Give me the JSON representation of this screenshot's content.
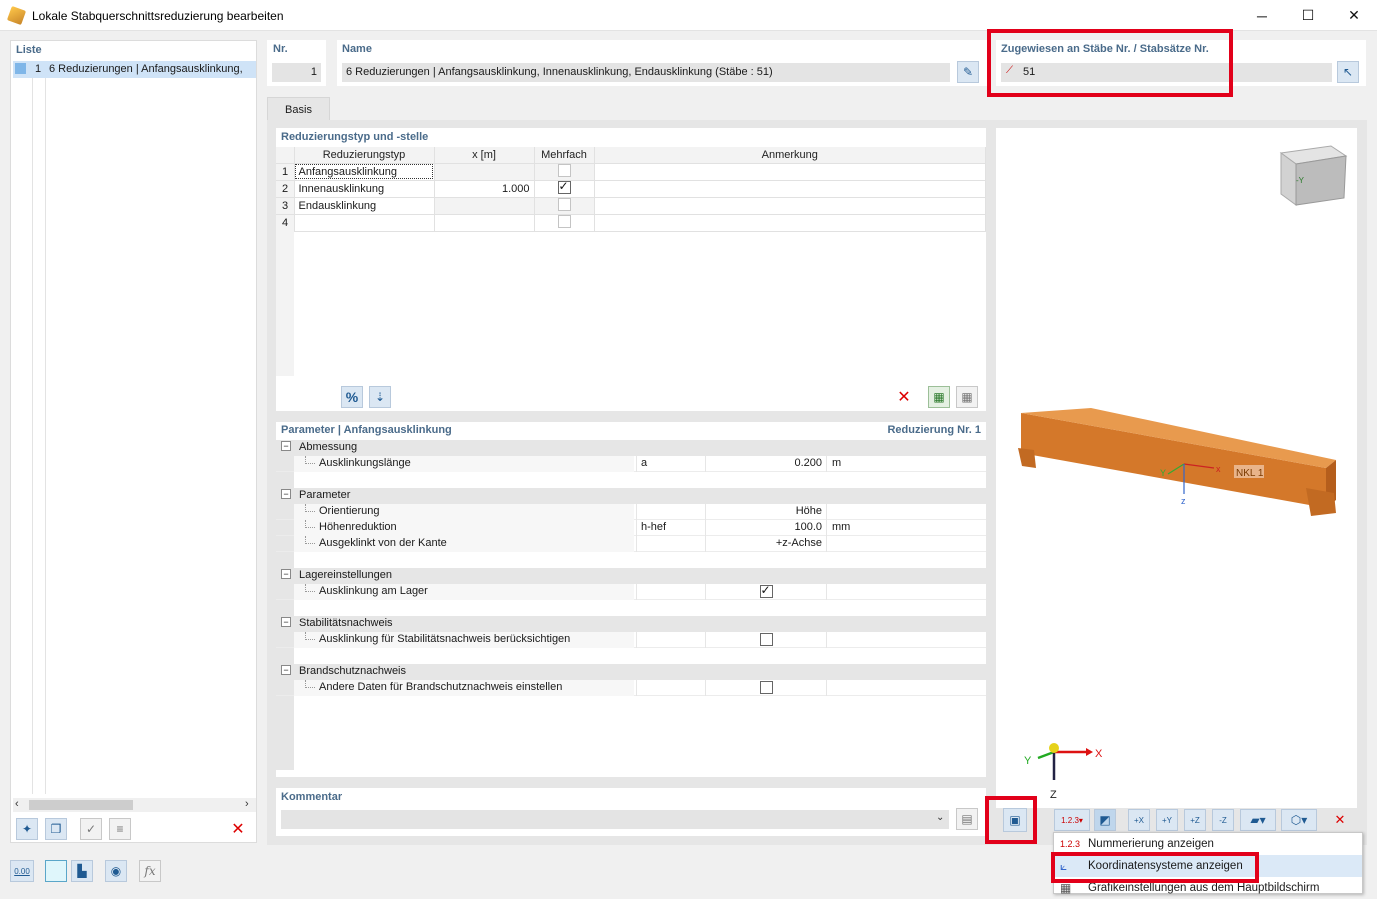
{
  "window": {
    "title": "Lokale Stabquerschnittsreduzierung bearbeiten",
    "minimize": "─",
    "maximize": "☐",
    "close": "✕"
  },
  "list": {
    "header": "Liste",
    "items": [
      {
        "no": "1",
        "label": "6 Reduzierungen | Anfangsausklinkung,"
      }
    ]
  },
  "nr": {
    "label": "Nr.",
    "value": "1"
  },
  "name": {
    "label": "Name",
    "value": "6 Reduzierungen | Anfangsausklinkung, Innenausklinkung, Endausklinkung (Stäbe : 51)"
  },
  "assigned": {
    "label": "Zugewiesen an Stäbe Nr. / Stabsätze Nr.",
    "value": "51"
  },
  "tabs": [
    {
      "label": "Basis"
    }
  ],
  "reductions": {
    "title": "Reduzierungstyp und -stelle",
    "columns": [
      "Reduzierungstyp",
      "x [m]",
      "Mehrfach",
      "Anmerkung"
    ],
    "rows": [
      {
        "no": "1",
        "type": "Anfangsausklinkung",
        "x": "",
        "multi": false,
        "multi_enabled": false,
        "note": ""
      },
      {
        "no": "2",
        "type": "Innenausklinkung",
        "x": "1.000",
        "multi": true,
        "multi_enabled": true,
        "note": ""
      },
      {
        "no": "3",
        "type": "Endausklinkung",
        "x": "",
        "multi": false,
        "multi_enabled": false,
        "note": ""
      },
      {
        "no": "4",
        "type": "",
        "x": "",
        "multi": false,
        "multi_enabled": false,
        "note": ""
      }
    ],
    "buttons": {
      "percent": "%",
      "sort": "⇣"
    }
  },
  "params": {
    "title": "Parameter | Anfangsausklinkung",
    "right_title": "Reduzierung Nr. 1",
    "groups": [
      {
        "name": "Abmessung",
        "rows": [
          {
            "label": "Ausklinkungslänge",
            "symbol": "a",
            "value": "0.200",
            "unit": "m"
          }
        ]
      },
      {
        "name": "Parameter",
        "rows": [
          {
            "label": "Orientierung",
            "symbol": "",
            "value": "Höhe",
            "unit": ""
          },
          {
            "label": "Höhenreduktion",
            "symbol": "h-hef",
            "value": "100.0",
            "unit": "mm"
          },
          {
            "label": "Ausgeklinkt von der Kante",
            "symbol": "",
            "value": "+z-Achse",
            "unit": ""
          }
        ]
      },
      {
        "name": "Lagereinstellungen",
        "rows": [
          {
            "label": "Ausklinkung am Lager",
            "symbol": "",
            "value": "",
            "unit": "",
            "checkbox": true,
            "checked": true
          }
        ]
      },
      {
        "name": "Stabilitätsnachweis",
        "rows": [
          {
            "label": "Ausklinkung für Stabilitätsnachweis berücksichtigen",
            "symbol": "",
            "value": "",
            "unit": "",
            "checkbox": true,
            "checked": false
          }
        ]
      },
      {
        "name": "Brandschutznachweis",
        "rows": [
          {
            "label": "Andere Daten für Brandschutznachweis einstellen",
            "symbol": "",
            "value": "",
            "unit": "",
            "checkbox": true,
            "checked": false
          }
        ]
      }
    ]
  },
  "comment": {
    "label": "Kommentar",
    "value": ""
  },
  "view3d": {
    "beam_label": "NKL 1",
    "local_axes": {
      "x": "x",
      "y": "Y",
      "z": "z"
    },
    "global_axes": {
      "x": "X",
      "y": "Y",
      "z": "Z"
    },
    "cube_label": "-Y"
  },
  "view_toolbar": {
    "numbering": "1.2.3",
    "axis_buttons": [
      "+X",
      "+Y",
      "+Z",
      "-Z"
    ]
  },
  "dropdown_menu": {
    "items": [
      {
        "label": "Nummerierung anzeigen",
        "icon": "1.2.3"
      },
      {
        "label": "Koordinatensysteme anzeigen",
        "icon": ""
      },
      {
        "label": "Grafikeinstellungen aus dem Hauptbildschirm",
        "icon": ""
      }
    ]
  },
  "statusbar": {
    "units": "0.00"
  },
  "colors": {
    "accent": "#1f5a92",
    "highlight": "#e2001a",
    "beam": "#d4782a",
    "list_select": "#cfe3f7"
  }
}
